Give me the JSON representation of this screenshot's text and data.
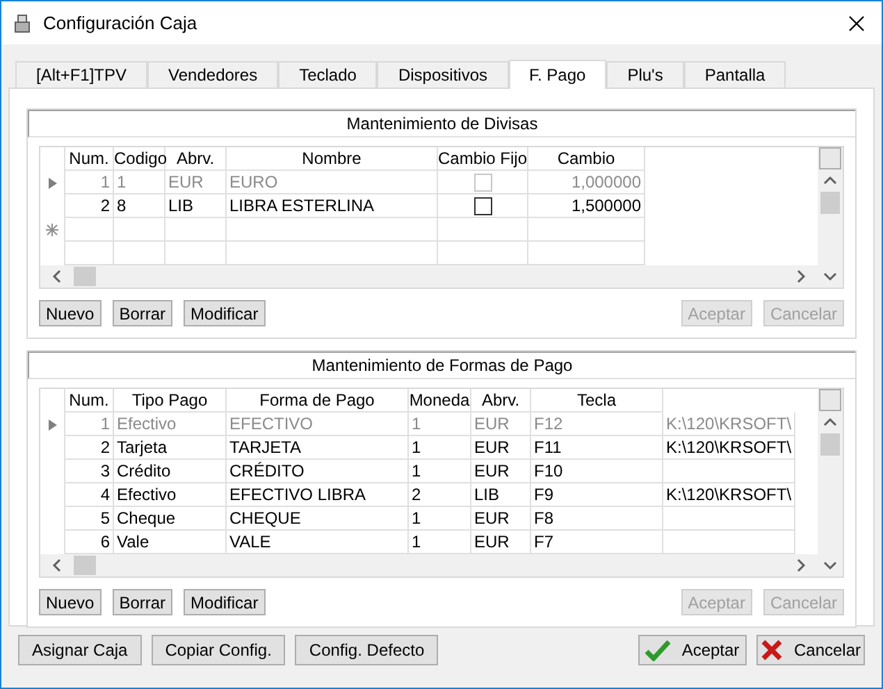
{
  "window": {
    "title": "Configuración Caja"
  },
  "tabs": [
    {
      "label": "[Alt+F1]TPV",
      "selected": false
    },
    {
      "label": "Vendedores",
      "selected": false
    },
    {
      "label": "Teclado",
      "selected": false
    },
    {
      "label": "Dispositivos",
      "selected": false
    },
    {
      "label": "F. Pago",
      "selected": true
    },
    {
      "label": "Plu's",
      "selected": false
    },
    {
      "label": "Pantalla",
      "selected": false
    }
  ],
  "divisas": {
    "title": "Mantenimiento de Divisas",
    "columns": [
      "Num.",
      "Codigo",
      "Abrv.",
      "Nombre",
      "Cambio Fijo",
      "Cambio"
    ],
    "rows": [
      {
        "num": "1",
        "codigo": "1",
        "abrv": "EUR",
        "nombre": "EURO",
        "cambio_fijo": false,
        "cambio": "1,000000",
        "current": true
      },
      {
        "num": "2",
        "codigo": "8",
        "abrv": "LIB",
        "nombre": "LIBRA ESTERLINA",
        "cambio_fijo": false,
        "cambio": "1,500000",
        "current": false
      }
    ],
    "buttons": [
      {
        "label": "Nuevo",
        "disabled": false
      },
      {
        "label": "Borrar",
        "disabled": false
      },
      {
        "label": "Modificar",
        "disabled": false
      },
      {
        "label": "Aceptar",
        "disabled": true
      },
      {
        "label": "Cancelar",
        "disabled": true
      }
    ]
  },
  "formas": {
    "title": "Mantenimiento de Formas de Pago",
    "columns": [
      "Num.",
      "Tipo Pago",
      "Forma de Pago",
      "Moneda",
      "Abrv.",
      "Tecla"
    ],
    "rows": [
      {
        "cells": [
          "1",
          "Efectivo",
          "EFECTIVO",
          "1",
          "EUR",
          "F12",
          "K:\\120\\KRSOFT\\"
        ],
        "current": true
      },
      {
        "cells": [
          "2",
          "Tarjeta",
          "TARJETA",
          "1",
          "EUR",
          "F11",
          "K:\\120\\KRSOFT\\"
        ],
        "current": false
      },
      {
        "cells": [
          "3",
          "Crédito",
          "CRÉDITO",
          "1",
          "EUR",
          "F10"
        ],
        "current": false
      },
      {
        "cells": [
          "4",
          "Efectivo",
          "EFECTIVO LIBRA",
          "2",
          "LIB",
          "F9",
          "K:\\120\\KRSOFT\\"
        ],
        "current": false
      },
      {
        "cells": [
          "5",
          "Cheque",
          "CHEQUE",
          "1",
          "EUR",
          "F8"
        ],
        "current": false
      },
      {
        "cells": [
          "6",
          "Vale",
          "VALE",
          "1",
          "EUR",
          "F7"
        ],
        "current": false
      }
    ],
    "buttons": [
      {
        "label": "Nuevo",
        "disabled": false
      },
      {
        "label": "Borrar",
        "disabled": false
      },
      {
        "label": "Modificar",
        "disabled": false
      },
      {
        "label": "Aceptar",
        "disabled": true
      },
      {
        "label": "Cancelar",
        "disabled": true
      }
    ]
  },
  "footer_buttons": [
    {
      "label": "Asignar Caja",
      "kind": "plain"
    },
    {
      "label": "Copiar Config.",
      "kind": "plain"
    },
    {
      "label": "Config. Defecto",
      "kind": "plain"
    },
    {
      "label": "Aceptar",
      "kind": "ok"
    },
    {
      "label": "Cancelar",
      "kind": "cancel"
    }
  ]
}
